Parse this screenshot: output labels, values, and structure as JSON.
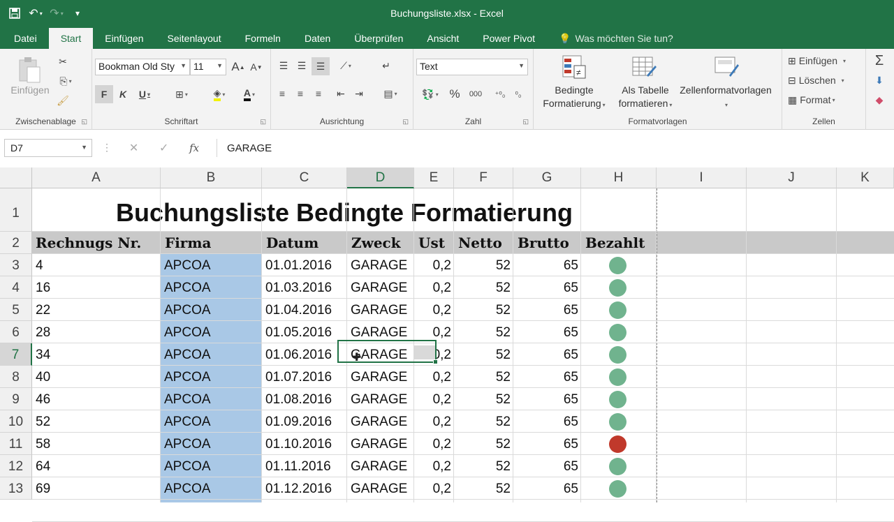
{
  "window": {
    "title": "Buchungsliste.xlsx - Excel"
  },
  "tabs": [
    "Datei",
    "Start",
    "Einfügen",
    "Seitenlayout",
    "Formeln",
    "Daten",
    "Überprüfen",
    "Ansicht",
    "Power Pivot"
  ],
  "tell_me": "Was möchten Sie tun?",
  "ribbon": {
    "clipboard": {
      "paste_label": "Einfügen",
      "group_label": "Zwischenablage"
    },
    "font": {
      "name": "Bookman Old Sty",
      "size": "11",
      "bold": "F",
      "italic": "K",
      "underline": "U",
      "grow": "A",
      "shrink": "A",
      "color_letter": "A",
      "group_label": "Schriftart"
    },
    "alignment": {
      "group_label": "Ausrichtung"
    },
    "number": {
      "format": "Text",
      "percent": "%",
      "thousands": "000",
      "group_label": "Zahl"
    },
    "styles": {
      "conditional_line1": "Bedingte",
      "conditional_line2": "Formatierung",
      "table_line1": "Als Tabelle",
      "table_line2": "formatieren",
      "cell_styles": "Zellenformatvorlagen",
      "group_label": "Formatvorlagen"
    },
    "cells": {
      "insert": "Einfügen",
      "delete": "Löschen",
      "format": "Format",
      "group_label": "Zellen"
    }
  },
  "formula_bar": {
    "name_box": "D7",
    "fx": "fx",
    "content": "GARAGE"
  },
  "columns": [
    "A",
    "B",
    "C",
    "D",
    "E",
    "F",
    "G",
    "H",
    "I",
    "J",
    "K"
  ],
  "rows": [
    "1",
    "2",
    "3",
    "4",
    "5",
    "6",
    "7",
    "8",
    "9",
    "10",
    "11",
    "12",
    "13"
  ],
  "sheet": {
    "title": "Buchungsliste Bedingte Formatierung",
    "headers": [
      "Rechnugs Nr.",
      "Firma",
      "Datum",
      "Zweck",
      "Ust",
      "Netto",
      "Brutto",
      "Bezahlt"
    ],
    "data": [
      [
        "4",
        "APCOA",
        "01.01.2016",
        "GARAGE",
        "0,2",
        "52",
        "65"
      ],
      [
        "16",
        "APCOA",
        "01.03.2016",
        "GARAGE",
        "0,2",
        "52",
        "65"
      ],
      [
        "22",
        "APCOA",
        "01.04.2016",
        "GARAGE",
        "0,2",
        "52",
        "65"
      ],
      [
        "28",
        "APCOA",
        "01.05.2016",
        "GARAGE",
        "0,2",
        "52",
        "65"
      ],
      [
        "34",
        "APCOA",
        "01.06.2016",
        "GARAGE",
        "0,2",
        "52",
        "65"
      ],
      [
        "40",
        "APCOA",
        "01.07.2016",
        "GARAGE",
        "0,2",
        "52",
        "65"
      ],
      [
        "46",
        "APCOA",
        "01.08.2016",
        "GARAGE",
        "0,2",
        "52",
        "65"
      ],
      [
        "52",
        "APCOA",
        "01.09.2016",
        "GARAGE",
        "0,2",
        "52",
        "65"
      ],
      [
        "58",
        "APCOA",
        "01.10.2016",
        "GARAGE",
        "0,2",
        "52",
        "65"
      ],
      [
        "64",
        "APCOA",
        "01.11.2016",
        "GARAGE",
        "0,2",
        "52",
        "65"
      ],
      [
        "69",
        "APCOA",
        "01.12.2016",
        "GARAGE",
        "0,2",
        "52",
        "65"
      ]
    ],
    "paid_status": [
      "green",
      "green",
      "green",
      "green",
      "green",
      "green",
      "green",
      "green",
      "red",
      "green",
      "green"
    ],
    "status_colors": {
      "green": "#70b38e",
      "red": "#c0392b"
    }
  },
  "colors": {
    "accent": "#217346",
    "firma_fill": "#a9c8e6",
    "header_fill": "#c9c9c9"
  }
}
